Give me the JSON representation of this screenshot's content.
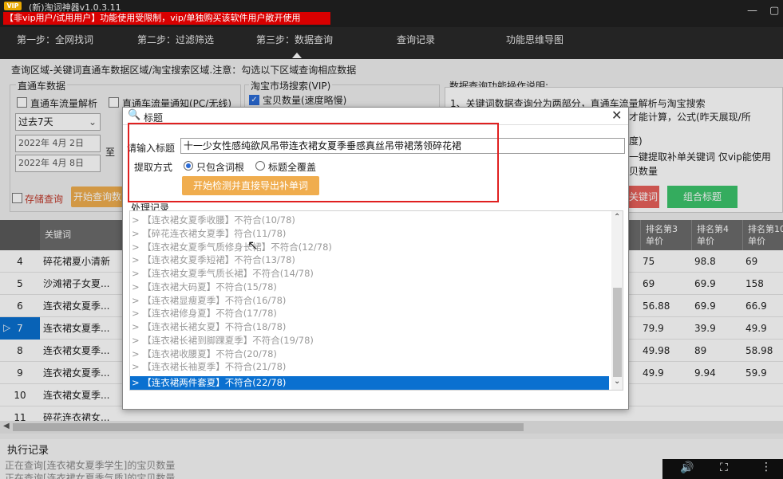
{
  "app": {
    "badge": "VIP",
    "title": "(新)淘词神器v1.0.3.11",
    "notice": "【非vip用户/试用用户】功能使用受限制，vip/单独购买该软件用户敞开使用"
  },
  "nav": {
    "items": [
      "第一步：全网找词",
      "第二步：过滤筛选",
      "第三步：数据查询",
      "查询记录",
      "功能思维导图"
    ]
  },
  "area_label": "查询区域-关键词直通车数据区域/淘宝搜索区域.注意：勾选以下区域查询相应数据",
  "ztc": {
    "title": "直通车数据",
    "flow_label": "直通车流量解析",
    "channel_label": "直通车流量通知(PC/无线)",
    "period": "过去7天",
    "date_from": "2022年 4月 2日",
    "date_to": "2022年 4月 8日",
    "to_label": "至",
    "save_query": "存储查询",
    "start_query": "开始查询数"
  },
  "taobao": {
    "title": "淘宝市场搜索(VIP)",
    "baby_count": "宝贝数量(速度略慢)"
  },
  "help": {
    "title": "数据查询功能操作说明:",
    "line1": "1、关键词数据查询分为两部分，直通车流量解析与淘宝搜索",
    "line2": "才能计算，公式(昨天展现/所",
    "line3": "度)",
    "line4": "一键提取补单关键词 仅vip能使用",
    "line5": "贝数量"
  },
  "buttons": {
    "keyword": "关键词",
    "combine_title": "组合标题"
  },
  "table": {
    "headers": [
      "关键词",
      "排名第3\n单价",
      "排名第4\n单价",
      "排名第10\n单价"
    ],
    "rows": [
      {
        "num": "4",
        "kw": "碎花裙夏小清新",
        "c3": "75",
        "c4": "98.8",
        "c10": "69"
      },
      {
        "num": "5",
        "kw": "沙滩裙子女夏...",
        "c3": "69",
        "c4": "69.9",
        "c10": "158"
      },
      {
        "num": "6",
        "kw": "连衣裙女夏季...",
        "c3": "56.88",
        "c4": "69.9",
        "c10": "66.9"
      },
      {
        "num": "7",
        "kw": "连衣裙女夏季...",
        "c3": "79.9",
        "c4": "39.9",
        "c10": "49.9"
      },
      {
        "num": "8",
        "kw": "连衣裙女夏季...",
        "c3": "49.98",
        "c4": "89",
        "c10": "58.98"
      },
      {
        "num": "9",
        "kw": "连衣裙女夏季...",
        "c3": "49.9",
        "c4": "9.94",
        "c10": "59.9"
      },
      {
        "num": "10",
        "kw": "连衣裙女夏季...",
        "c3": "",
        "c4": "",
        "c10": ""
      },
      {
        "num": "11",
        "kw": "碎花连衣裙女...",
        "c3": "",
        "c4": "",
        "c10": ""
      }
    ]
  },
  "dialog": {
    "title": "标题",
    "input_label": "请输入标题",
    "input_value": "十一少女性感纯欲风吊带连衣裙女夏季垂感真丝吊带裙荡领碎花裙",
    "mode_label": "提取方式",
    "mode_a": "只包含词根",
    "mode_b": "标题全覆盖",
    "action": "开始检测并直接导出补单词",
    "log_title": "处理记录",
    "log": [
      "【连衣裙女夏季收腰】不符合(10/78)",
      "【碎花连衣裙女夏季】符合(11/78)",
      "【连衣裙女夏季气质修身长裙】不符合(12/78)",
      "【连衣裙女夏季短裙】不符合(13/78)",
      "【连衣裙女夏季气质长裙】不符合(14/78)",
      "【连衣裙大码夏】不符合(15/78)",
      "【连衣裙显瘦夏季】不符合(16/78)",
      "【连衣裙修身夏】不符合(17/78)",
      "【连衣裙长裙女夏】不符合(18/78)",
      "【连衣裙长裙到脚踝夏季】不符合(19/78)",
      "【连衣裙收腰夏】不符合(20/78)",
      "【连衣裙长袖夏季】不符合(21/78)",
      "【连衣裙两件套夏】不符合(22/78)"
    ]
  },
  "status": {
    "title": "执行记录",
    "line1": "正在查询[连衣裙女夏季学生]的宝贝数量",
    "line2": "正在查询[连衣裙女夏季气质]的宝贝数量"
  }
}
